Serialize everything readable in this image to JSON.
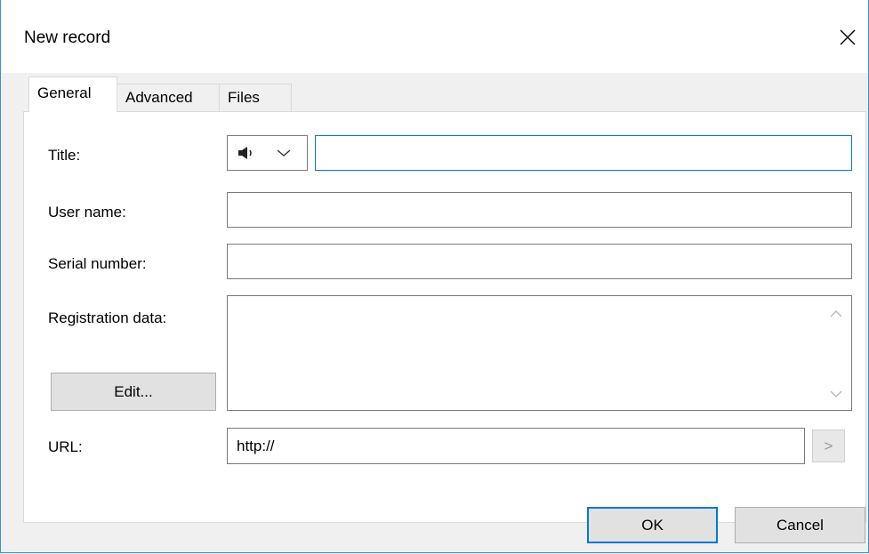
{
  "window": {
    "title": "New record"
  },
  "tabs": [
    {
      "label": "General",
      "active": true
    },
    {
      "label": "Advanced",
      "active": false
    },
    {
      "label": "Files",
      "active": false
    }
  ],
  "form": {
    "title_label": "Title:",
    "title_value": "",
    "title_icon": "speaker-icon",
    "username_label": "User name:",
    "username_value": "",
    "serial_label": "Serial number:",
    "serial_value": "",
    "regdata_label": "Registration data:",
    "regdata_value": "",
    "edit_button": "Edit...",
    "url_label": "URL:",
    "url_value": "http://",
    "url_go": ">"
  },
  "footer": {
    "ok": "OK",
    "cancel": "Cancel"
  },
  "colors": {
    "accent": "#0078d7",
    "border": "#7a7a7a",
    "button_bg": "#e1e1e1"
  }
}
